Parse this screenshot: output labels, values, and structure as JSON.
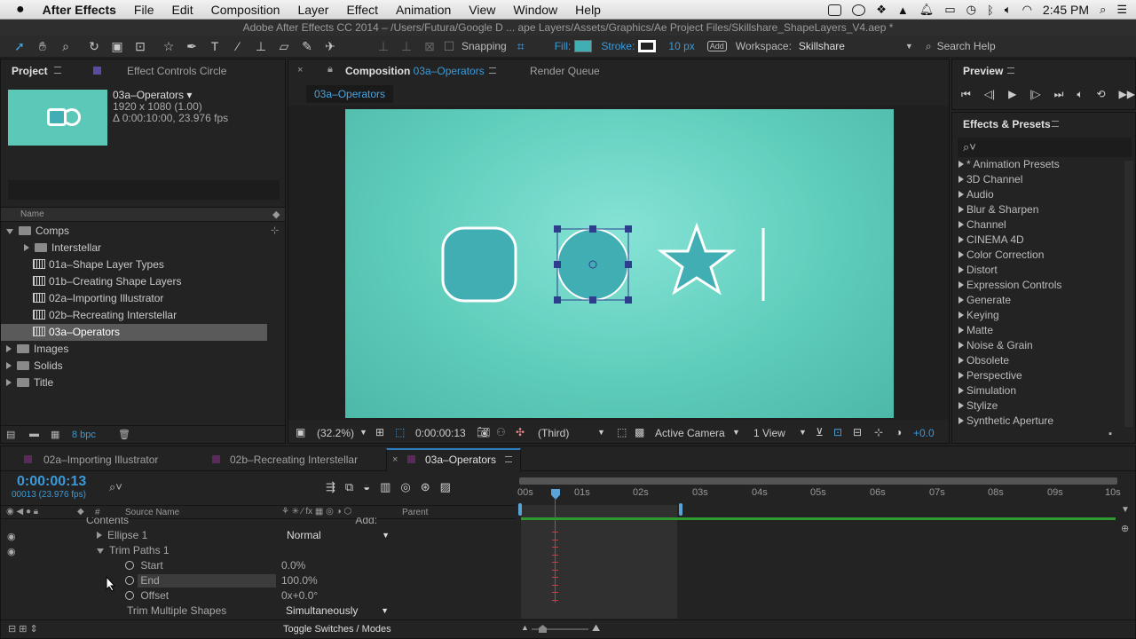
{
  "menubar": {
    "app": "After Effects",
    "items": [
      "File",
      "Edit",
      "Composition",
      "Layer",
      "Effect",
      "Animation",
      "View",
      "Window",
      "Help"
    ],
    "clock": "2:45 PM"
  },
  "window_title": "Adobe After Effects CC 2014 – /Users/Futura/Google D ... ape Layers/Assets/Graphics/Ae Project Files/Skillshare_ShapeLayers_V4.aep *",
  "toolbar": {
    "snapping": "Snapping",
    "fill": "Fill:",
    "stroke": "Stroke:",
    "stroke_width": "10 px",
    "workspace_label": "Workspace:",
    "workspace_value": "Skillshare",
    "search_help": "Search Help"
  },
  "project": {
    "tab": "Project",
    "tab2": "Effect Controls Circle",
    "comp_name": "03a–Operators ▾",
    "comp_size": "1920 x 1080 (1.00)",
    "comp_duration": "Δ 0:00:10:00, 23.976 fps",
    "col_name": "Name",
    "bpc": "8 bpc",
    "items": [
      {
        "label": "Comps",
        "type": "folder",
        "open": true
      },
      {
        "label": "Interstellar",
        "type": "folder"
      },
      {
        "label": "01a–Shape Layer Types",
        "type": "comp"
      },
      {
        "label": "01b–Creating Shape Layers",
        "type": "comp"
      },
      {
        "label": "02a–Importing Illustrator",
        "type": "comp"
      },
      {
        "label": "02b–Recreating Interstellar",
        "type": "comp"
      },
      {
        "label": "03a–Operators",
        "type": "comp",
        "selected": true
      },
      {
        "label": "Images",
        "type": "folder"
      },
      {
        "label": "Solids",
        "type": "folder"
      },
      {
        "label": "Title",
        "type": "folder"
      }
    ]
  },
  "composition": {
    "tab_prefix": "Composition",
    "tab_name": "03a–Operators",
    "render_queue": "Render Queue",
    "breadcrumb": "03a–Operators",
    "zoom": "(32.2%)",
    "timecode": "0:00:00:13",
    "resolution": "(Third)",
    "camera": "Active Camera",
    "views": "1 View",
    "exposure": "+0.0"
  },
  "preview": {
    "tab": "Preview"
  },
  "effects": {
    "tab": "Effects & Presets",
    "items": [
      "* Animation Presets",
      "3D Channel",
      "Audio",
      "Blur & Sharpen",
      "Channel",
      "CINEMA 4D",
      "Color Correction",
      "Distort",
      "Expression Controls",
      "Generate",
      "Keying",
      "Matte",
      "Noise & Grain",
      "Obsolete",
      "Perspective",
      "Simulation",
      "Stylize",
      "Synthetic Aperture"
    ]
  },
  "timeline": {
    "tabs": [
      "02a–Importing Illustrator",
      "02b–Recreating Interstellar",
      "03a–Operators"
    ],
    "timecode": "0:00:00:13",
    "frames": "00013 (23.976 fps)",
    "col_hash": "#",
    "col_source": "Source Name",
    "col_parent": "Parent",
    "ruler": [
      "00s",
      "01s",
      "02s",
      "03s",
      "04s",
      "05s",
      "06s",
      "07s",
      "08s",
      "09s",
      "10s"
    ],
    "contents": "Contents",
    "add": "Add:",
    "ellipse": "Ellipse 1",
    "blend_mode": "Normal",
    "trim_paths": "Trim Paths 1",
    "start_label": "Start",
    "start_value": "0.0%",
    "end_label": "End",
    "end_value": "100.0%",
    "offset_label": "Offset",
    "offset_value": "0x+0.0°",
    "trim_multiple": "Trim Multiple Shapes",
    "trim_multiple_value": "Simultaneously",
    "toggle": "Toggle Switches / Modes"
  },
  "colors": {
    "accent": "#3a9ad9",
    "canvas": "#5cc8b8",
    "shape_fill": "#41aeb4"
  }
}
